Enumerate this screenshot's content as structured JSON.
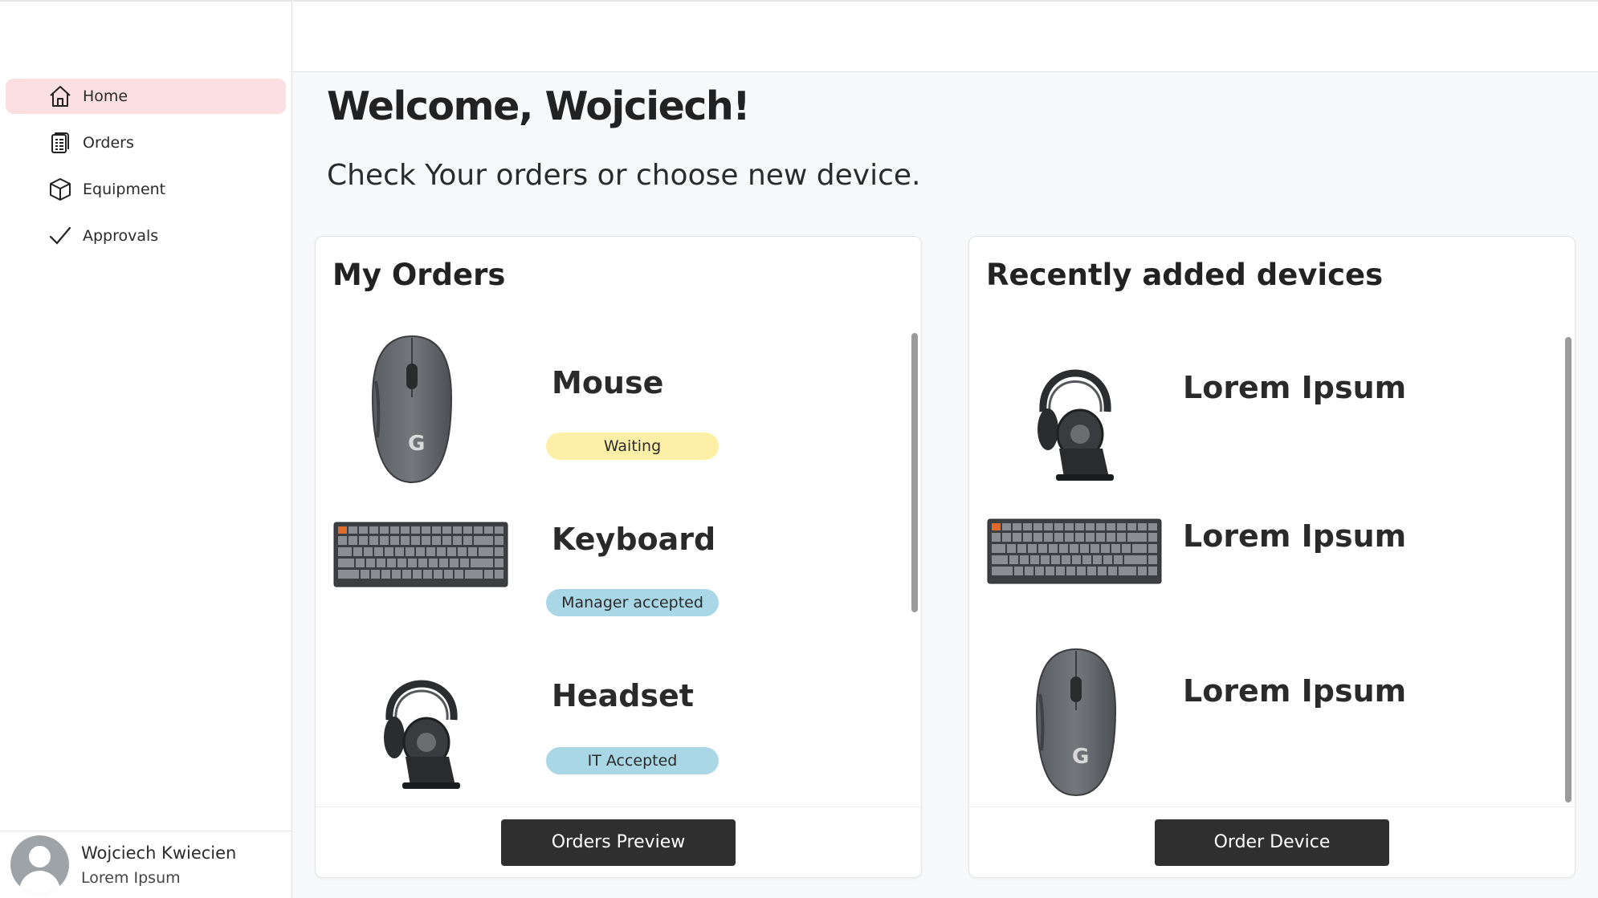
{
  "sidebar": {
    "items": [
      {
        "label": "Home",
        "icon": "home-icon",
        "active": true
      },
      {
        "label": "Orders",
        "icon": "clipboard-icon",
        "active": false
      },
      {
        "label": "Equipment",
        "icon": "cube-icon",
        "active": false
      },
      {
        "label": "Approvals",
        "icon": "checkmark-icon",
        "active": false
      }
    ],
    "user": {
      "name": "Wojciech Kwiecien",
      "role": "Lorem Ipsum",
      "icon": "avatar-icon"
    }
  },
  "main": {
    "title": "Welcome, Wojciech!",
    "subtitle": "Check Your orders or choose new device."
  },
  "orders": {
    "title": "My Orders",
    "items": [
      {
        "name": "Mouse",
        "status": "Waiting",
        "status_kind": "waiting",
        "image": "mouse-image"
      },
      {
        "name": "Keyboard",
        "status": "Manager accepted",
        "status_kind": "accepted",
        "image": "keyboard-image"
      },
      {
        "name": "Headset",
        "status": "IT Accepted",
        "status_kind": "accepted",
        "image": "headset-image"
      }
    ],
    "button_label": "Orders Preview"
  },
  "devices": {
    "title": "Recently added devices",
    "items": [
      {
        "name": "Lorem Ipsum",
        "image": "headset-image"
      },
      {
        "name": "Lorem Ipsum",
        "image": "keyboard-image"
      },
      {
        "name": "Lorem Ipsum",
        "image": "mouse-image"
      }
    ],
    "button_label": "Order Device"
  },
  "colors": {
    "active_nav": "#fbdfe2",
    "waiting_badge": "#fdf0a6",
    "accepted_badge": "#a9d7e6",
    "button": "#2f2f2f"
  }
}
